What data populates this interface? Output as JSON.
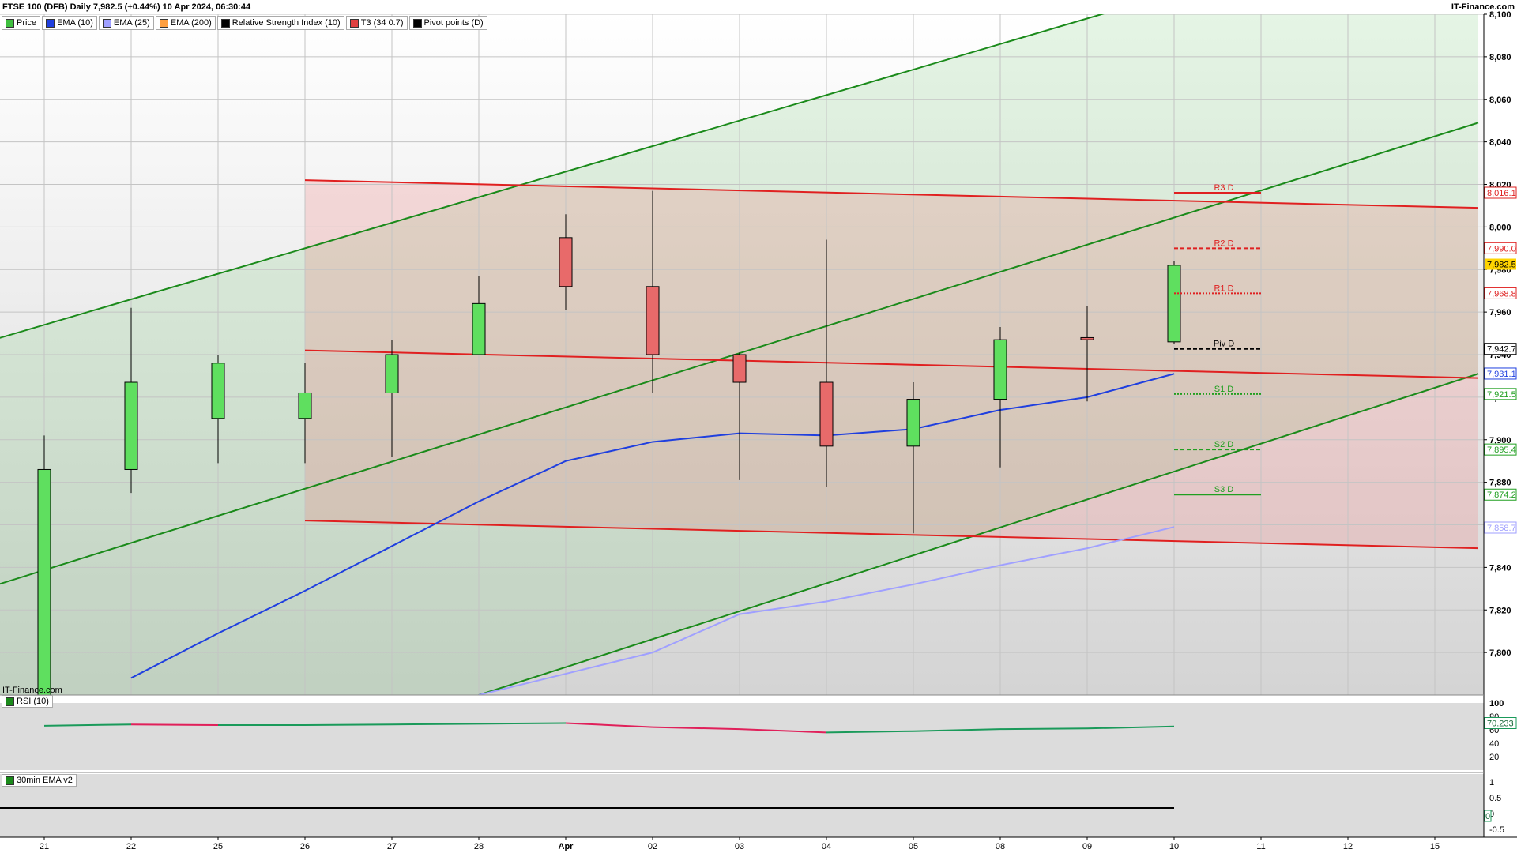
{
  "header": {
    "title": "FTSE 100 (DFB) Daily 7,982.5 (+0.44%) 10 Apr 2024, 06:30:44",
    "brand": "IT-Finance.com",
    "watermark": "IT-Finance.com"
  },
  "legend": [
    {
      "label": "Price",
      "color": "#3fbf3f"
    },
    {
      "label": "EMA (10)",
      "color": "#1f3fdf"
    },
    {
      "label": "EMA (25)",
      "color": "#9f9fff"
    },
    {
      "label": "EMA (200)",
      "color": "#ff9f3f"
    },
    {
      "label": "Relative Strength Index (10)",
      "color": "#000000"
    },
    {
      "label": "T3 (34 0.7)",
      "color": "#df3f3f"
    },
    {
      "label": "Pivot points (D)",
      "color": "#000000"
    }
  ],
  "rsi_pane": {
    "label": "RSI (10)",
    "value_tag": "70.233"
  },
  "ema_pane": {
    "label": "30min EMA v2"
  },
  "chart_data": [
    {
      "type": "candlestick",
      "x": [
        "21",
        "22",
        "25",
        "26",
        "27",
        "28",
        "Apr",
        "02",
        "03",
        "04",
        "05",
        "08",
        "09",
        "10",
        "11",
        "12",
        "15"
      ],
      "ylim": [
        7780,
        8100
      ],
      "yticks": [
        7800,
        7820,
        7840,
        7860,
        7880,
        7900,
        7920,
        7940,
        7960,
        7980,
        8000,
        8020,
        8040,
        8060,
        8080,
        8100
      ],
      "ytick_labels": [
        "7,800",
        "7,820",
        "7,840",
        "7,860",
        "7,880",
        "7,900",
        "7,920",
        "7,940",
        "7,960",
        "7,980",
        "8,000",
        "8,020",
        "8,040",
        "8,060",
        "8,080",
        "8,100"
      ],
      "candles": [
        {
          "x": "21",
          "open": 7780,
          "high": 7902,
          "low": 7780,
          "close": 7886
        },
        {
          "x": "22",
          "open": 7886,
          "high": 7962,
          "low": 7875,
          "close": 7927
        },
        {
          "x": "25",
          "open": 7910,
          "high": 7940,
          "low": 7889,
          "close": 7936
        },
        {
          "x": "26",
          "open": 7910,
          "high": 7936,
          "low": 7889,
          "close": 7922
        },
        {
          "x": "27",
          "open": 7922,
          "high": 7947,
          "low": 7892,
          "close": 7940
        },
        {
          "x": "28",
          "open": 7940,
          "high": 7977,
          "low": 7940,
          "close": 7964
        },
        {
          "x": "Apr",
          "open": 7995,
          "high": 8006,
          "low": 7961,
          "close": 7972
        },
        {
          "x": "02",
          "open": 7972,
          "high": 8017,
          "low": 7922,
          "close": 7940
        },
        {
          "x": "03",
          "open": 7940,
          "high": 7941,
          "low": 7881,
          "close": 7927
        },
        {
          "x": "04",
          "open": 7927,
          "high": 7994,
          "low": 7878,
          "close": 7897
        },
        {
          "x": "05",
          "open": 7897,
          "high": 7927,
          "low": 7856,
          "close": 7919
        },
        {
          "x": "08",
          "open": 7919,
          "high": 7953,
          "low": 7887,
          "close": 7947
        },
        {
          "x": "09",
          "open": 7948,
          "high": 7963,
          "low": 7918,
          "close": 7947
        },
        {
          "x": "10",
          "open": 7946,
          "high": 7984,
          "low": 7945,
          "close": 7982
        }
      ],
      "ema10": {
        "x": [
          "22",
          "25",
          "26",
          "27",
          "28",
          "Apr",
          "02",
          "03",
          "04",
          "05",
          "08",
          "09",
          "10"
        ],
        "values": [
          7788,
          7809,
          7829,
          7850,
          7871,
          7890,
          7899,
          7903,
          7902,
          7905,
          7914,
          7920,
          7931
        ]
      },
      "ema25": {
        "x": [
          "28",
          "Apr",
          "02",
          "03",
          "04",
          "05",
          "08",
          "09",
          "10"
        ],
        "values": [
          7780,
          7790,
          7800,
          7818,
          7824,
          7832,
          7841,
          7849,
          7859
        ]
      },
      "pivots": [
        {
          "label": "R3 D",
          "value": 8016.1,
          "tag": "8,016.1",
          "style": "solid",
          "color": "#df2020"
        },
        {
          "label": "R2 D",
          "value": 7990.0,
          "tag": "7,990.0",
          "style": "dashed",
          "color": "#df2020"
        },
        {
          "label": "R1 D",
          "value": 7968.8,
          "tag": "7,968.8",
          "style": "dotted",
          "color": "#df2020"
        },
        {
          "label": "Piv D",
          "value": 7942.7,
          "tag": "7,942.7",
          "style": "dashed",
          "color": "#000000"
        },
        {
          "label": "S1 D",
          "value": 7921.5,
          "tag": "7,921.5",
          "style": "dotted",
          "color": "#209f20"
        },
        {
          "label": "S2 D",
          "value": 7895.4,
          "tag": "7,895.4",
          "style": "dashed",
          "color": "#209f20"
        },
        {
          "label": "S3 D",
          "value": 7874.2,
          "tag": "7,874.2",
          "style": "solid",
          "color": "#209f20"
        }
      ],
      "last_price_tag": "7,982.5",
      "ema10_tag": "7,931.1",
      "ema25_tag": "7,858.7",
      "green_channel": [
        {
          "x0": "20",
          "y0": 7942,
          "x1": "11",
          "y1": 8122
        },
        {
          "x0": "20",
          "y0": 7826,
          "x1": "15.5",
          "y1": 8049
        },
        {
          "x0": "28",
          "y0": 7780,
          "x1": "15.5",
          "y1": 7931
        }
      ],
      "red_channel": [
        {
          "x0": "26",
          "y0": 8022,
          "x1": "15.5",
          "y1": 8009
        },
        {
          "x0": "26",
          "y0": 7942,
          "x1": "15.5",
          "y1": 7929
        },
        {
          "x0": "26",
          "y0": 7862,
          "x1": "15.5",
          "y1": 7849
        }
      ],
      "colors": {
        "up": "#5fdf5f",
        "down": "#e86a6a",
        "wick": "#000000",
        "ema10": "#1f3fdf",
        "ema25": "#a0a0ff",
        "green_line": "#1a8a1a",
        "red_line": "#e02020"
      }
    },
    {
      "type": "line",
      "title": "RSI (10)",
      "ylim": [
        0,
        100
      ],
      "yticks": [
        20,
        40,
        60,
        80,
        100
      ],
      "ytick_labels": [
        "20",
        "40",
        "60",
        "80",
        "100"
      ],
      "x": [
        "21",
        "22",
        "25",
        "26",
        "27",
        "28",
        "Apr",
        "02",
        "03",
        "04",
        "05",
        "08",
        "09",
        "10"
      ],
      "values": [
        66,
        68,
        67,
        67,
        68,
        69,
        70,
        64,
        61,
        56,
        58,
        61,
        62,
        65
      ],
      "reference_lines": [
        70,
        30
      ],
      "last_value": "70.233"
    },
    {
      "type": "line",
      "title": "30min EMA v2",
      "yticks": [
        1,
        0.5,
        0,
        -0.5
      ],
      "ytick_labels": [
        "1",
        "0.5",
        "0",
        "-0.5"
      ],
      "values_constant": 0,
      "zero_tag": "0"
    }
  ]
}
